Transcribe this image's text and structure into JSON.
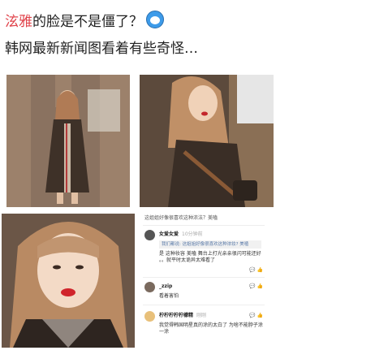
{
  "post": {
    "name": "泫雅",
    "question": "的脸是不是僵了？",
    "subtitle": "韩网最新新闻图看着有些奇怪…"
  },
  "photos": [
    {
      "bg": "#8a7260",
      "label": "photo-full-body"
    },
    {
      "bg": "#5c4a3c",
      "label": "photo-side-pose"
    },
    {
      "bg": "#6b5647",
      "label": "photo-closeup"
    }
  ],
  "comments": {
    "header_text": "这姐姐好像很喜欢这种浓法？美嗑",
    "items": [
      {
        "user": "女爱女爱",
        "meta": "10分钟前",
        "quote": "我们都说: 这姐姐好像很喜欢这种浓妆? 美嗑",
        "text": "是 这种妆容 美嗑 舞台上打光亲亲很闪可能还好 。。就平时太诡异太难看了"
      },
      {
        "user": "_zzip",
        "meta": "",
        "text": "看着害怕"
      },
      {
        "user": "柠柠柠柠柠檬精",
        "meta": "刚刚",
        "text": "我觉得韩国明星真的涂的太白了 为啥不能脖子涂一涂"
      }
    ]
  },
  "colors": {
    "accent_name": "#e0434b",
    "quote_text": "#5a7aa8"
  }
}
